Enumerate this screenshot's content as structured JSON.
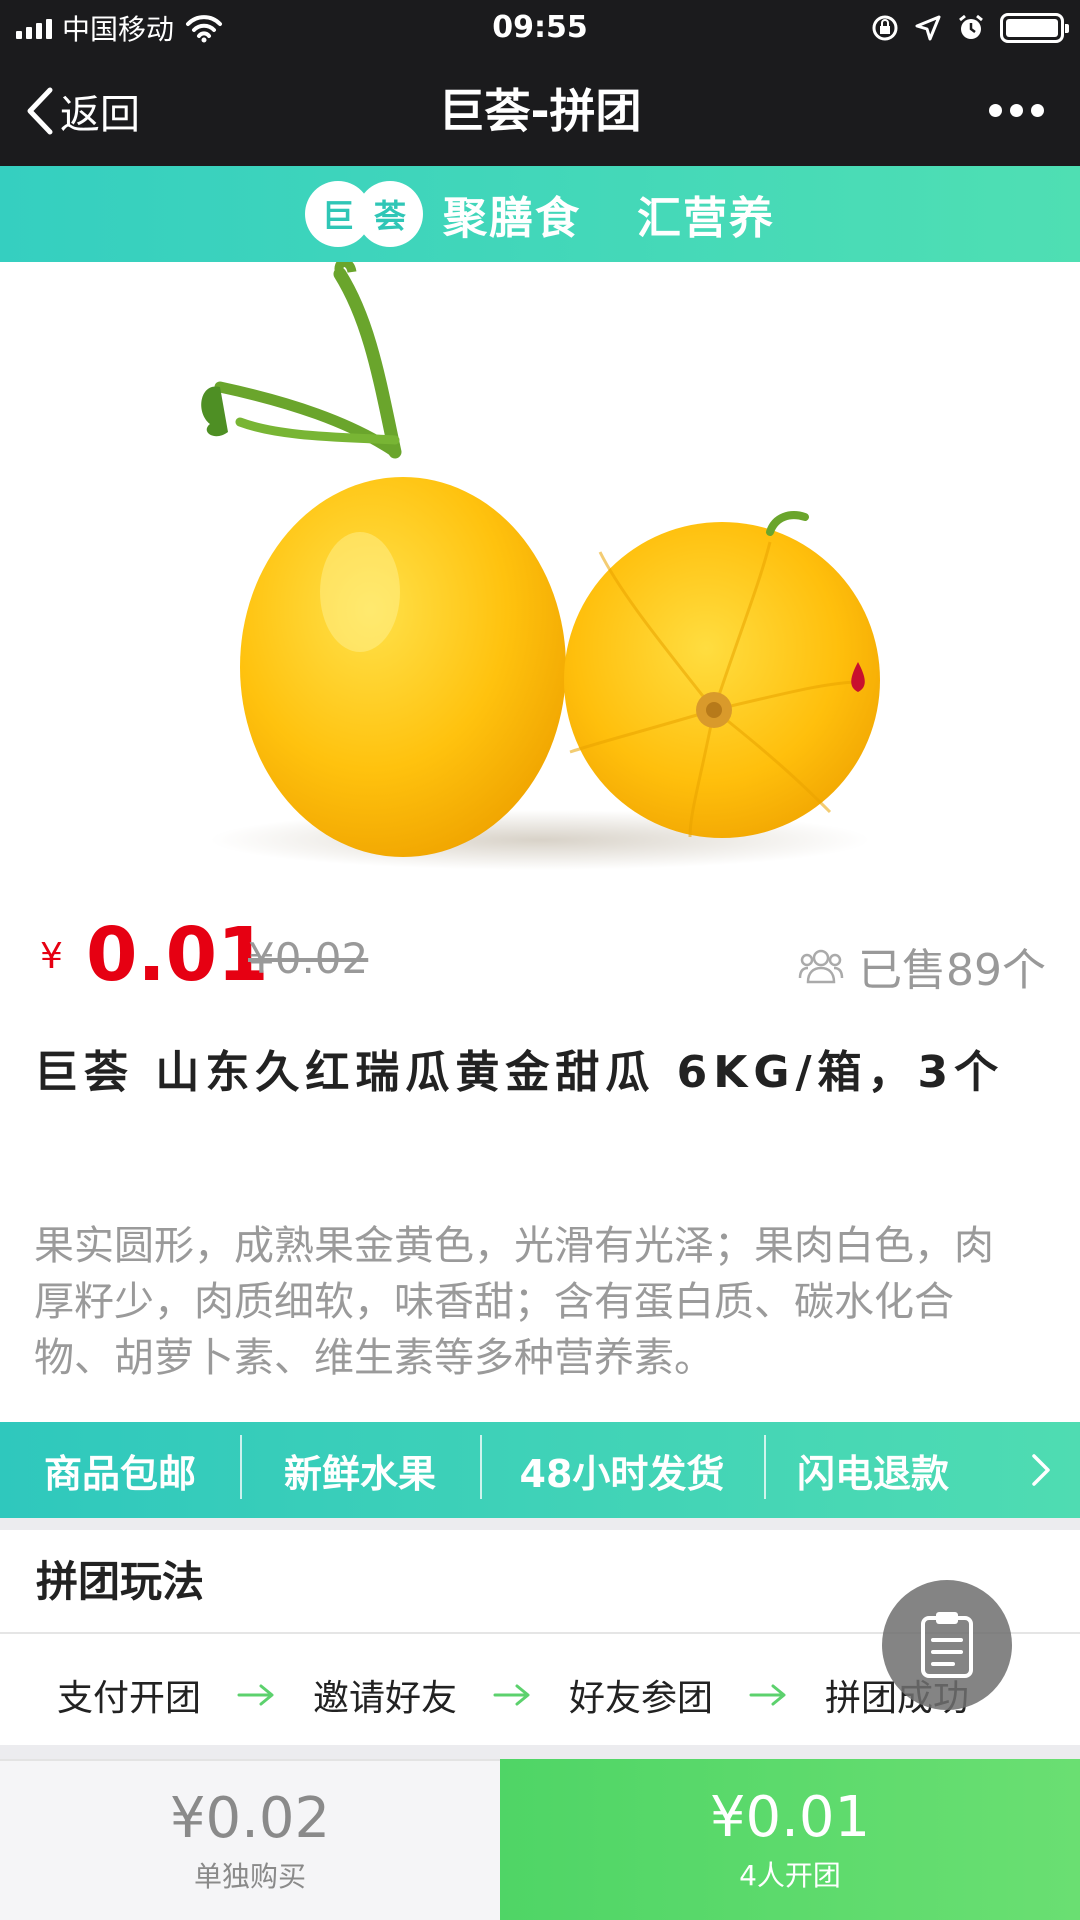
{
  "status_bar": {
    "carrier": "中国移动",
    "time": "09:55"
  },
  "nav": {
    "back_label": "返回",
    "title": "巨荟-拼团"
  },
  "banner": {
    "logo_chars": [
      "巨",
      "荟"
    ],
    "slogan_1": "聚膳食",
    "slogan_2": "汇营养"
  },
  "product": {
    "currency": "¥",
    "price": "0.01",
    "original_price": "¥0.02",
    "sold": "已售89个",
    "title": "巨荟 山东久红瑞瓜黄金甜瓜 6KG/箱，3个",
    "description": "果实圆形，成熟果金黄色，光滑有光泽；果肉白色，肉厚籽少，肉质细软，味香甜；含有蛋白质、碳水化合物、胡萝卜素、维生素等多种营养素。"
  },
  "features": [
    "商品包邮",
    "新鲜水果",
    "48小时发货",
    "闪电退款"
  ],
  "rules": {
    "header": "拼团玩法",
    "steps": [
      "支付开团",
      "邀请好友",
      "好友参团",
      "拼团成功"
    ]
  },
  "bottom_bar": {
    "single_price": "¥0.02",
    "single_label": "单独购买",
    "group_price": "¥0.01",
    "group_label": "4人开团"
  },
  "colors": {
    "accent_teal": "#35cfc0",
    "price_red": "#e60012",
    "group_green": "#4fd566",
    "nav_dark": "#1b1b1d"
  }
}
